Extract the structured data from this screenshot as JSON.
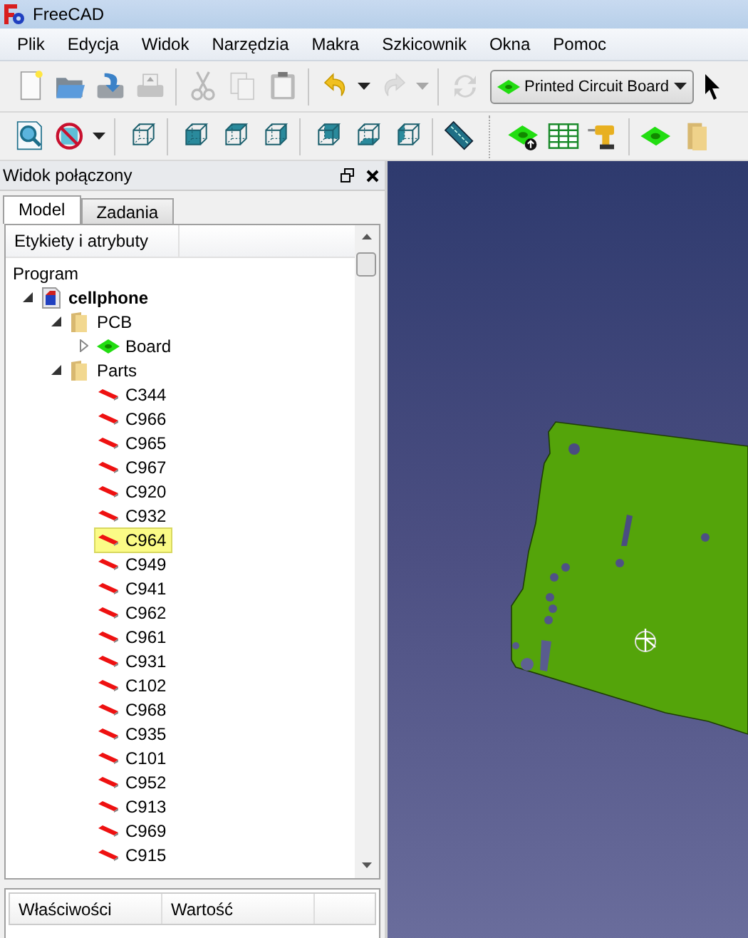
{
  "window": {
    "title": "FreeCAD"
  },
  "menu": [
    "Plik",
    "Edycja",
    "Widok",
    "Narzędzia",
    "Makra",
    "Szkicownik",
    "Okna",
    "Pomoc"
  ],
  "toolbar_top": [
    {
      "kind": "new",
      "disabled": false
    },
    {
      "kind": "open",
      "disabled": false
    },
    {
      "kind": "save",
      "disabled": false
    },
    {
      "kind": "print",
      "disabled": true
    },
    {
      "kind": "separator"
    },
    {
      "kind": "cut",
      "disabled": true
    },
    {
      "kind": "copy",
      "disabled": true
    },
    {
      "kind": "paste",
      "disabled": false
    },
    {
      "kind": "separator"
    },
    {
      "kind": "undo",
      "disabled": false
    },
    {
      "kind": "dropdown",
      "disabled": false
    },
    {
      "kind": "redo",
      "disabled": true
    },
    {
      "kind": "dropdown",
      "disabled": true
    },
    {
      "kind": "separator"
    },
    {
      "kind": "refresh",
      "disabled": true
    }
  ],
  "workbench": {
    "value": "Printed Circuit Board"
  },
  "toolbar_view": [
    {
      "kind": "fit",
      "disabled": false
    },
    {
      "kind": "drawstyle",
      "disabled": false
    },
    {
      "kind": "dropdown",
      "disabled": false
    },
    {
      "kind": "separator"
    },
    {
      "kind": "cube-iso",
      "disabled": false
    },
    {
      "kind": "separator"
    },
    {
      "kind": "cube-front",
      "disabled": false
    },
    {
      "kind": "cube-top",
      "disabled": false
    },
    {
      "kind": "cube-right",
      "disabled": false
    },
    {
      "kind": "separator"
    },
    {
      "kind": "cube-rear",
      "disabled": false
    },
    {
      "kind": "cube-bottom",
      "disabled": false
    },
    {
      "kind": "cube-left",
      "disabled": false
    },
    {
      "kind": "separator"
    },
    {
      "kind": "ruler",
      "disabled": false
    },
    {
      "kind": "gap"
    },
    {
      "kind": "board-upload",
      "disabled": false
    },
    {
      "kind": "spreadsheet",
      "disabled": false
    },
    {
      "kind": "drill",
      "disabled": false
    },
    {
      "kind": "separator"
    },
    {
      "kind": "board",
      "disabled": false
    },
    {
      "kind": "folder",
      "disabled": false
    }
  ],
  "panel": {
    "title": "Widok połączony",
    "tabs": [
      {
        "label": "Model",
        "selected": true
      },
      {
        "label": "Zadania",
        "selected": false
      }
    ],
    "tree": {
      "header": "Etykiety i atrybuty",
      "root": "Program",
      "items": [
        {
          "label": "cellphone",
          "kind": "document",
          "expanded": true,
          "selected": false,
          "children": [
            {
              "label": "PCB",
              "kind": "folder",
              "expanded": true,
              "selected": false,
              "children": [
                {
                  "label": "Board",
                  "kind": "board",
                  "expanded": false,
                  "selected": false
                }
              ]
            },
            {
              "label": "Parts",
              "kind": "folder",
              "expanded": true,
              "selected": false,
              "children": [
                {
                  "label": "C344",
                  "kind": "part",
                  "selected": false
                },
                {
                  "label": "C966",
                  "kind": "part",
                  "selected": false
                },
                {
                  "label": "C965",
                  "kind": "part",
                  "selected": false
                },
                {
                  "label": "C967",
                  "kind": "part",
                  "selected": false
                },
                {
                  "label": "C920",
                  "kind": "part",
                  "selected": false
                },
                {
                  "label": "C932",
                  "kind": "part",
                  "selected": false
                },
                {
                  "label": "C964",
                  "kind": "part",
                  "selected": true
                },
                {
                  "label": "C949",
                  "kind": "part",
                  "selected": false
                },
                {
                  "label": "C941",
                  "kind": "part",
                  "selected": false
                },
                {
                  "label": "C962",
                  "kind": "part",
                  "selected": false
                },
                {
                  "label": "C961",
                  "kind": "part",
                  "selected": false
                },
                {
                  "label": "C931",
                  "kind": "part",
                  "selected": false
                },
                {
                  "label": "C102",
                  "kind": "part",
                  "selected": false
                },
                {
                  "label": "C968",
                  "kind": "part",
                  "selected": false
                },
                {
                  "label": "C935",
                  "kind": "part",
                  "selected": false
                },
                {
                  "label": "C101",
                  "kind": "part",
                  "selected": false
                },
                {
                  "label": "C952",
                  "kind": "part",
                  "selected": false
                },
                {
                  "label": "C913",
                  "kind": "part",
                  "selected": false
                },
                {
                  "label": "C969",
                  "kind": "part",
                  "selected": false
                },
                {
                  "label": "C915",
                  "kind": "part",
                  "selected": false
                }
              ]
            }
          ]
        }
      ]
    },
    "properties": {
      "columns": [
        "Właściwości",
        "Wartość"
      ]
    }
  }
}
